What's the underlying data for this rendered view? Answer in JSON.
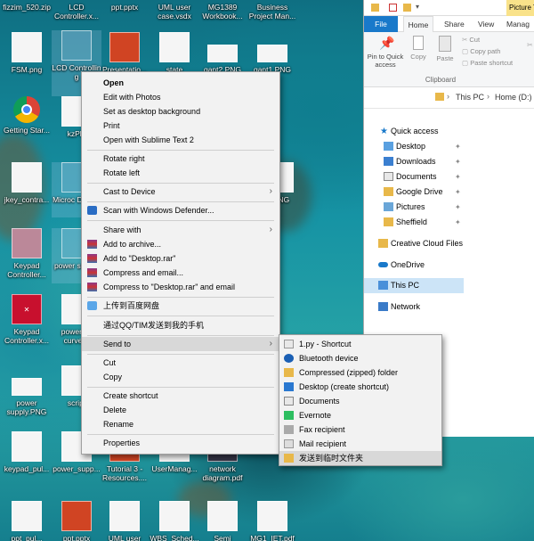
{
  "desktop": {
    "icons_row1": [
      "fizzim_520.zip",
      "LCD Controller.x...",
      "ppt.pptx",
      "UML user case.vsdx",
      "MG1389 Workbook...",
      "Business Project Man..."
    ],
    "icons_row2": [
      "FSM.png",
      "LCD Controllin g",
      "Presentatio...",
      "state",
      "gant2.PNG",
      "gant1.PNG"
    ],
    "icons_left": [
      "Getting Star...",
      "kzPhl",
      "jkey_contra...",
      "Microc Design",
      "Keypad Controller...",
      "power supply",
      "Keypad Controller.x...",
      "power su curve.P",
      "power supply.PNG",
      "script",
      "keypad_pul...",
      "power_supp...",
      "ppt_pul...",
      "ppt.pptx"
    ],
    "icons_bottom": [
      "Tutorial 3 - Resources....",
      "UserManag...",
      "network diagram.pdf",
      "UML user",
      "WBS_Sched...",
      "Semi",
      "MG1_IET.pdf"
    ],
    "icons_misc": [
      "PNG"
    ]
  },
  "explorer": {
    "context_tab": "Picture Too",
    "tabs": {
      "file": "File",
      "home": "Home",
      "share": "Share",
      "view": "View",
      "manage": "Manag"
    },
    "ribbon": {
      "pin": "Pin to Quick access",
      "copy": "Copy",
      "paste": "Paste",
      "cut": "Cut",
      "copy_path": "Copy path",
      "paste_shortcut": "Paste shortcut",
      "group": "Clipboard"
    },
    "address": {
      "root": "This PC",
      "current": "Home (D:)"
    },
    "nav": {
      "quick_access": "Quick access",
      "desktop": "Desktop",
      "downloads": "Downloads",
      "documents": "Documents",
      "google_drive": "Google Drive",
      "pictures": "Pictures",
      "sheffield": "Sheffield",
      "creative_cloud": "Creative Cloud Files",
      "onedrive": "OneDrive",
      "this_pc": "This PC",
      "network": "Network"
    }
  },
  "context_menu": {
    "open": "Open",
    "edit_photos": "Edit with Photos",
    "set_bg": "Set as desktop background",
    "print": "Print",
    "open_sublime": "Open with Sublime Text 2",
    "rotate_right": "Rotate right",
    "rotate_left": "Rotate left",
    "cast": "Cast to Device",
    "defender": "Scan with Windows Defender...",
    "share_with": "Share with",
    "add_archive": "Add to archive...",
    "add_desktop_rar": "Add to \"Desktop.rar\"",
    "compress_email": "Compress and email...",
    "compress_rar_email": "Compress to \"Desktop.rar\" and email",
    "baidu": "上传到百度网盘",
    "qq": "通过QQ/TIM发送到我的手机",
    "send_to": "Send to",
    "cut": "Cut",
    "copy": "Copy",
    "create_shortcut": "Create shortcut",
    "delete": "Delete",
    "rename": "Rename",
    "properties": "Properties"
  },
  "send_to_menu": {
    "py_shortcut": "1.py - Shortcut",
    "bluetooth": "Bluetooth device",
    "zip": "Compressed (zipped) folder",
    "desktop_shortcut": "Desktop (create shortcut)",
    "documents": "Documents",
    "evernote": "Evernote",
    "fax": "Fax recipient",
    "mail": "Mail recipient",
    "temp_folder": "发送到临时文件夹"
  },
  "colors": {
    "file_tab": "#1979ca",
    "context_tab": "#f9e28a",
    "menu_bg": "#f2f2f2",
    "menu_highlight": "#d8d8d8"
  }
}
